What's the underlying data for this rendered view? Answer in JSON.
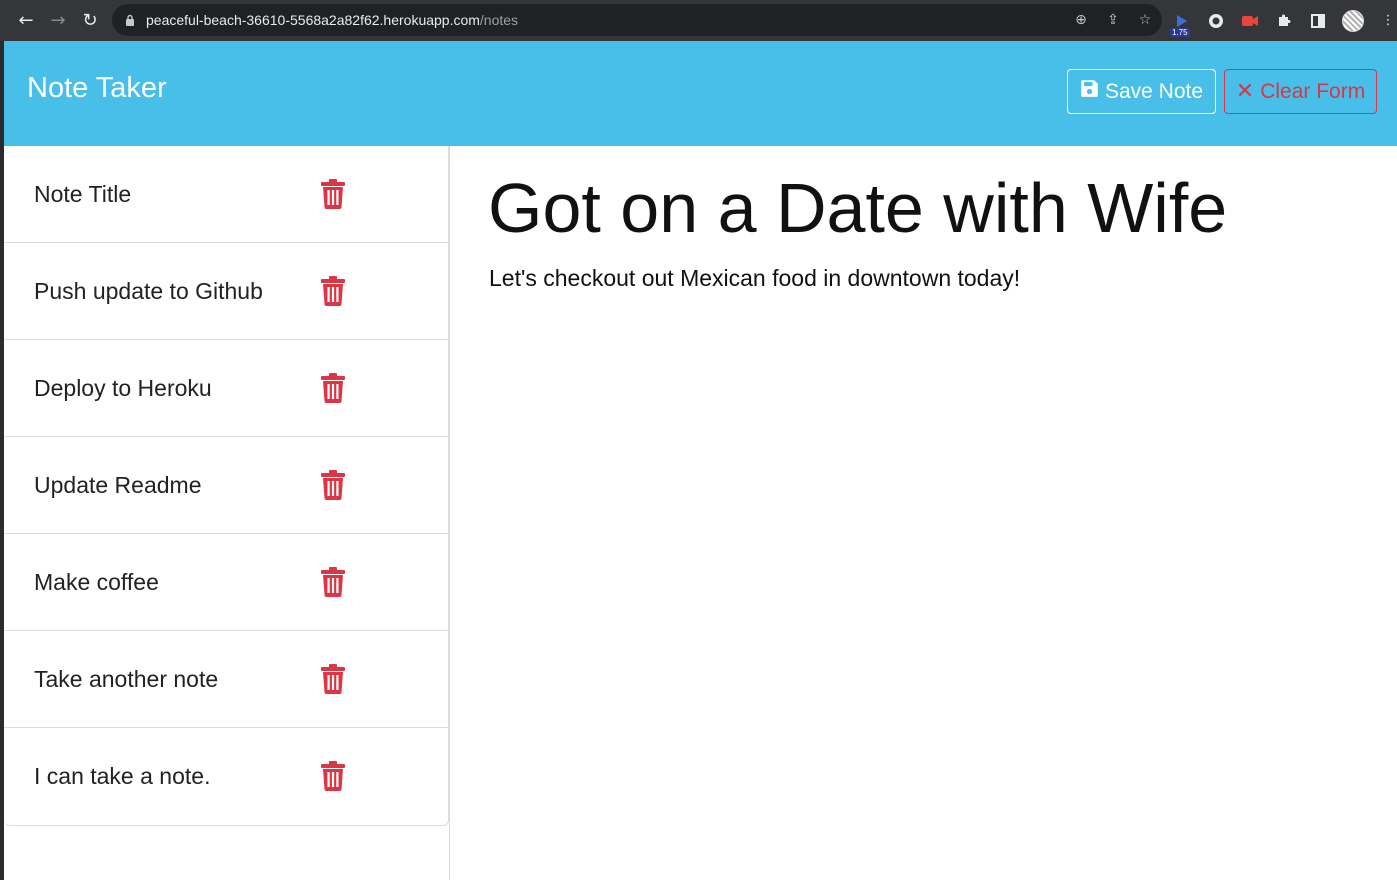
{
  "browser": {
    "url_host": "peaceful-beach-36610-5568a2a82f62.herokuapp.com",
    "url_path": "/notes",
    "extension_badge": "1.75"
  },
  "navbar": {
    "brand": "Note Taker",
    "save_label": "Save Note",
    "clear_label": "Clear Form"
  },
  "notes": [
    {
      "title": "Note Title"
    },
    {
      "title": "Push update to Github"
    },
    {
      "title": "Deploy to Heroku"
    },
    {
      "title": "Update Readme"
    },
    {
      "title": "Make coffee"
    },
    {
      "title": "Take another note"
    },
    {
      "title": "I can take a note."
    }
  ],
  "active_note": {
    "title": "Got on a Date with Wife",
    "text": "Let's checkout out Mexican food in downtown today!"
  },
  "colors": {
    "navbar": "#48bfe9",
    "danger": "#dc3545"
  }
}
